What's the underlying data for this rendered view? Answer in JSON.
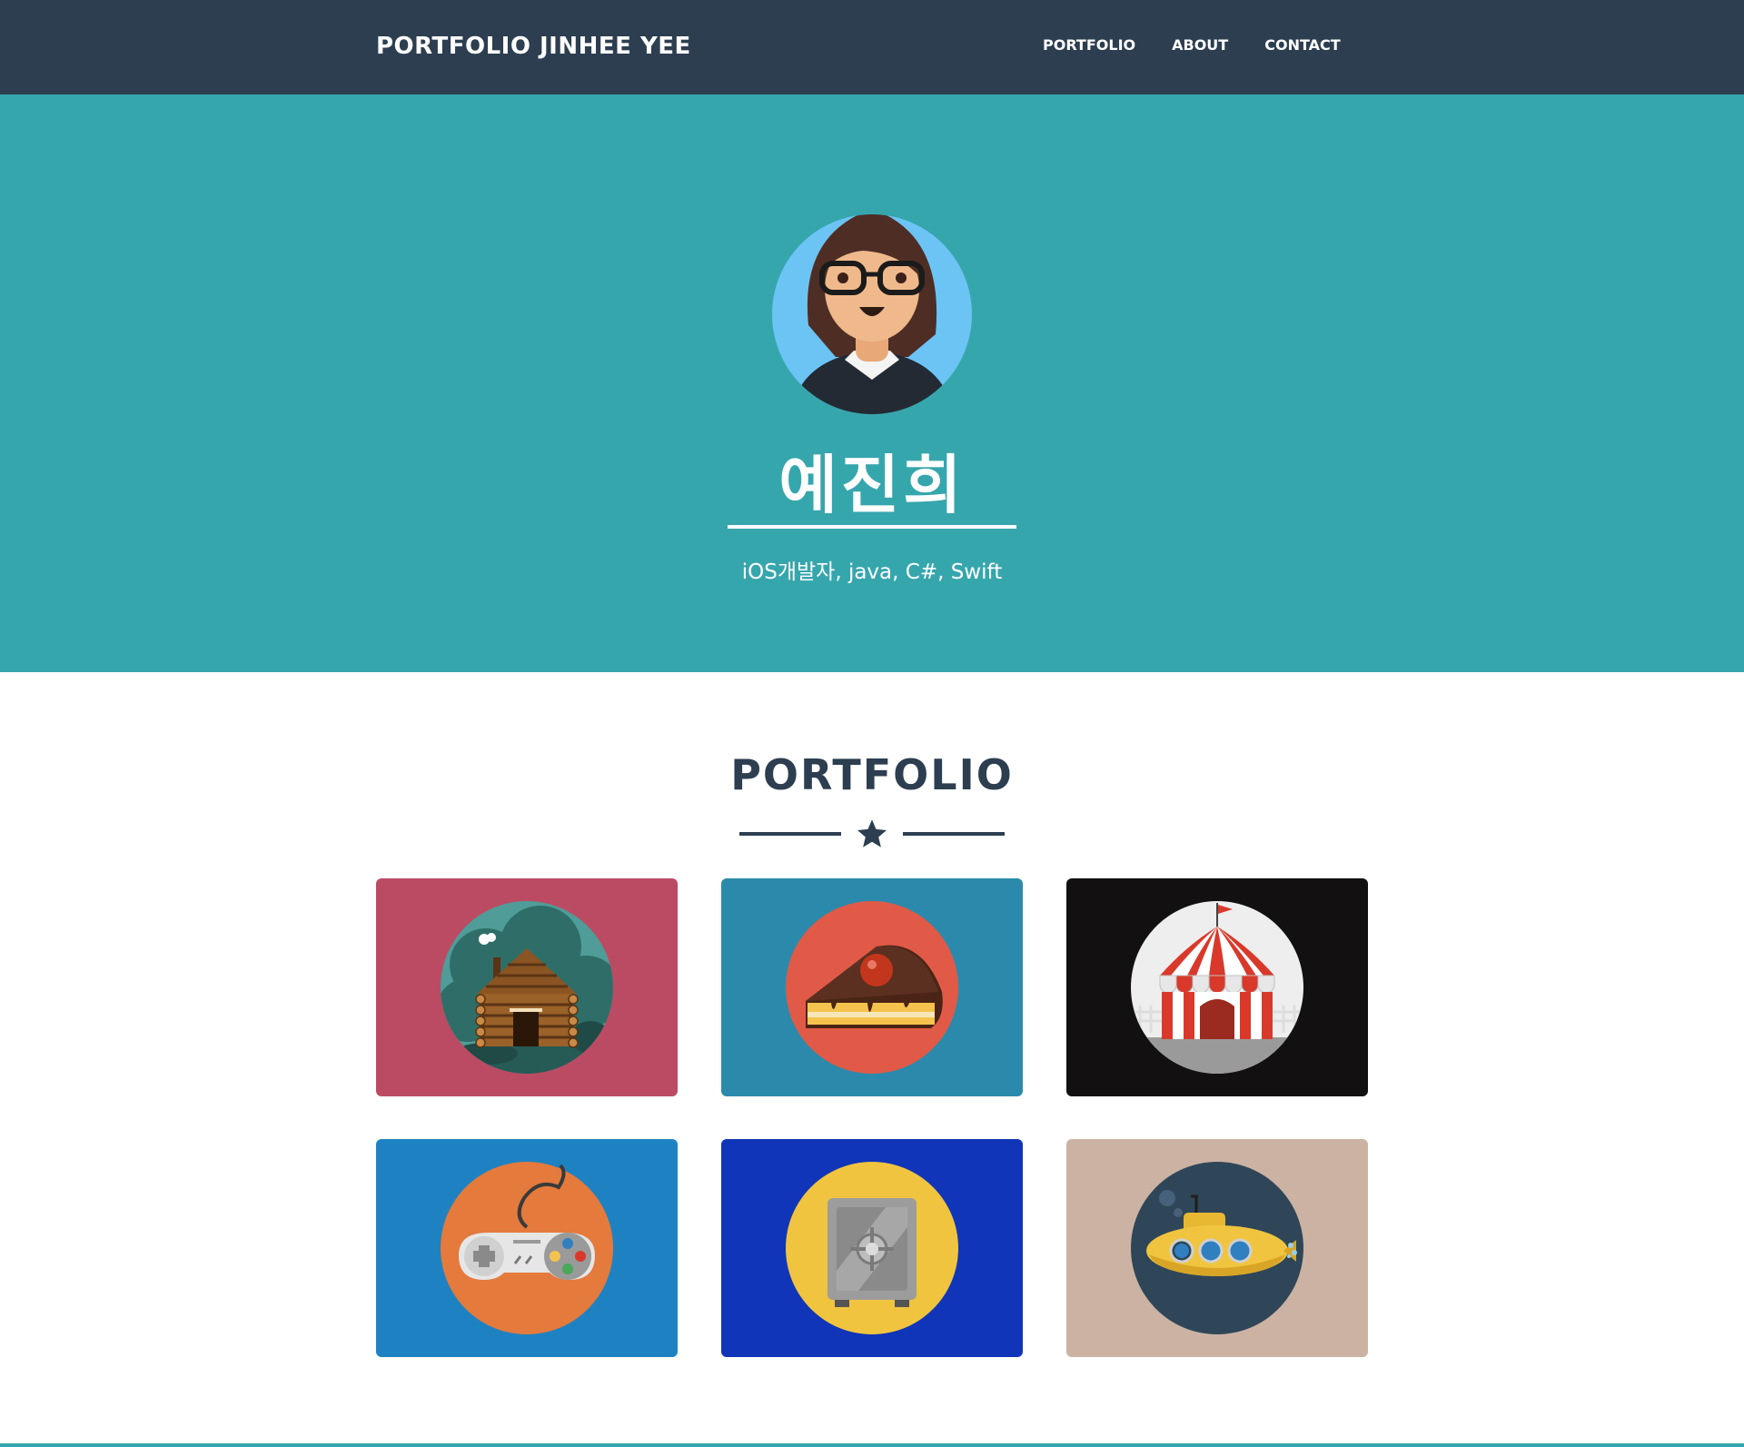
{
  "navbar": {
    "brand": "PORTFOLIO JINHEE YEE",
    "links": [
      "PORTFOLIO",
      "ABOUT",
      "CONTACT"
    ]
  },
  "masthead": {
    "name": "예진희",
    "subtitle": "iOS개발자, java, C#, Swift",
    "avatar_icon": "female-developer-avatar-icon"
  },
  "portfolio": {
    "heading": "PORTFOLIO",
    "divider_icon": "star-icon",
    "items": [
      {
        "icon": "log-cabin-icon",
        "background": "#bb4b63"
      },
      {
        "icon": "cake-slice-icon",
        "background": "#2b8aab"
      },
      {
        "icon": "circus-tent-icon",
        "background": "#121010"
      },
      {
        "icon": "game-controller-icon",
        "background": "#1e82c2"
      },
      {
        "icon": "safe-icon",
        "background": "#1035b8"
      },
      {
        "icon": "submarine-icon",
        "background": "#ccb2a3"
      }
    ]
  },
  "colors": {
    "navbar": "#2c3e50",
    "masthead": "#36a6ad",
    "heading": "#2c3e50"
  }
}
